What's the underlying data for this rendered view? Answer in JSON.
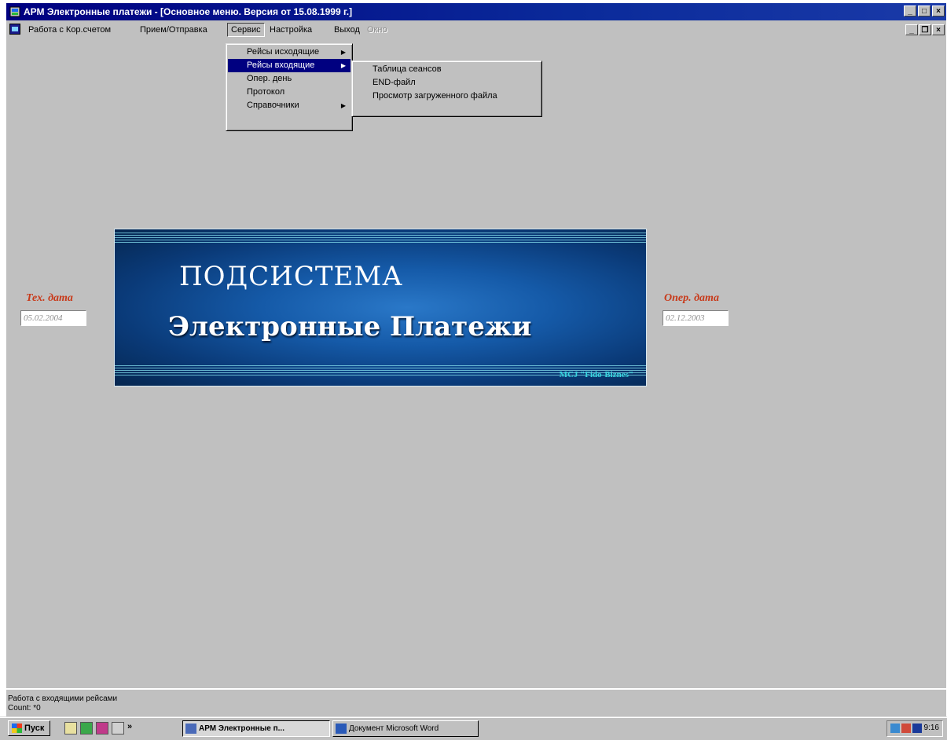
{
  "window": {
    "title": "АРМ Электронные платежи - [Основное меню. Версия от 15.08.1999 г.]",
    "buttons": {
      "minimize": "_",
      "maximize": "□",
      "close": "×"
    }
  },
  "menubar": {
    "items": [
      "Работа с Кор.счетом",
      "Прием/Отправка",
      "Сервис",
      "Настройка",
      "Выход",
      "Окно"
    ],
    "mdi_buttons": {
      "minimize": "_",
      "restore": "❐",
      "close": "×"
    }
  },
  "service_menu": {
    "items": [
      "Рейсы исходящие",
      "Рейсы входящие",
      "Опер. день",
      "Протокол",
      "Справочники"
    ]
  },
  "incoming_submenu": {
    "items": [
      "Таблица сеансов",
      "END-файл",
      "Просмотр загруженного файла"
    ]
  },
  "tech_date": {
    "label": "Тех. дата",
    "value": "05.02.2004"
  },
  "oper_date": {
    "label": "Опер. дата",
    "value": "02.12.2003"
  },
  "banner": {
    "line1": "ПОДСИСТЕМА",
    "line2": "Электронные Платежи",
    "brand": "МСЈ \"Fido-Biznes\""
  },
  "status": {
    "line1": "Работа с входящими рейсами",
    "line2": "Count: *0"
  },
  "taskbar": {
    "start_label": "Пуск",
    "chevron": "»",
    "tasks": [
      "АРМ Электронные п...",
      "Документ Microsoft Word"
    ],
    "clock": "9:16"
  },
  "colors": {
    "title_bar": "#000080",
    "menu_highlight": "#000080",
    "date_label": "#c83a1a",
    "banner_brand": "#39d7e0"
  }
}
